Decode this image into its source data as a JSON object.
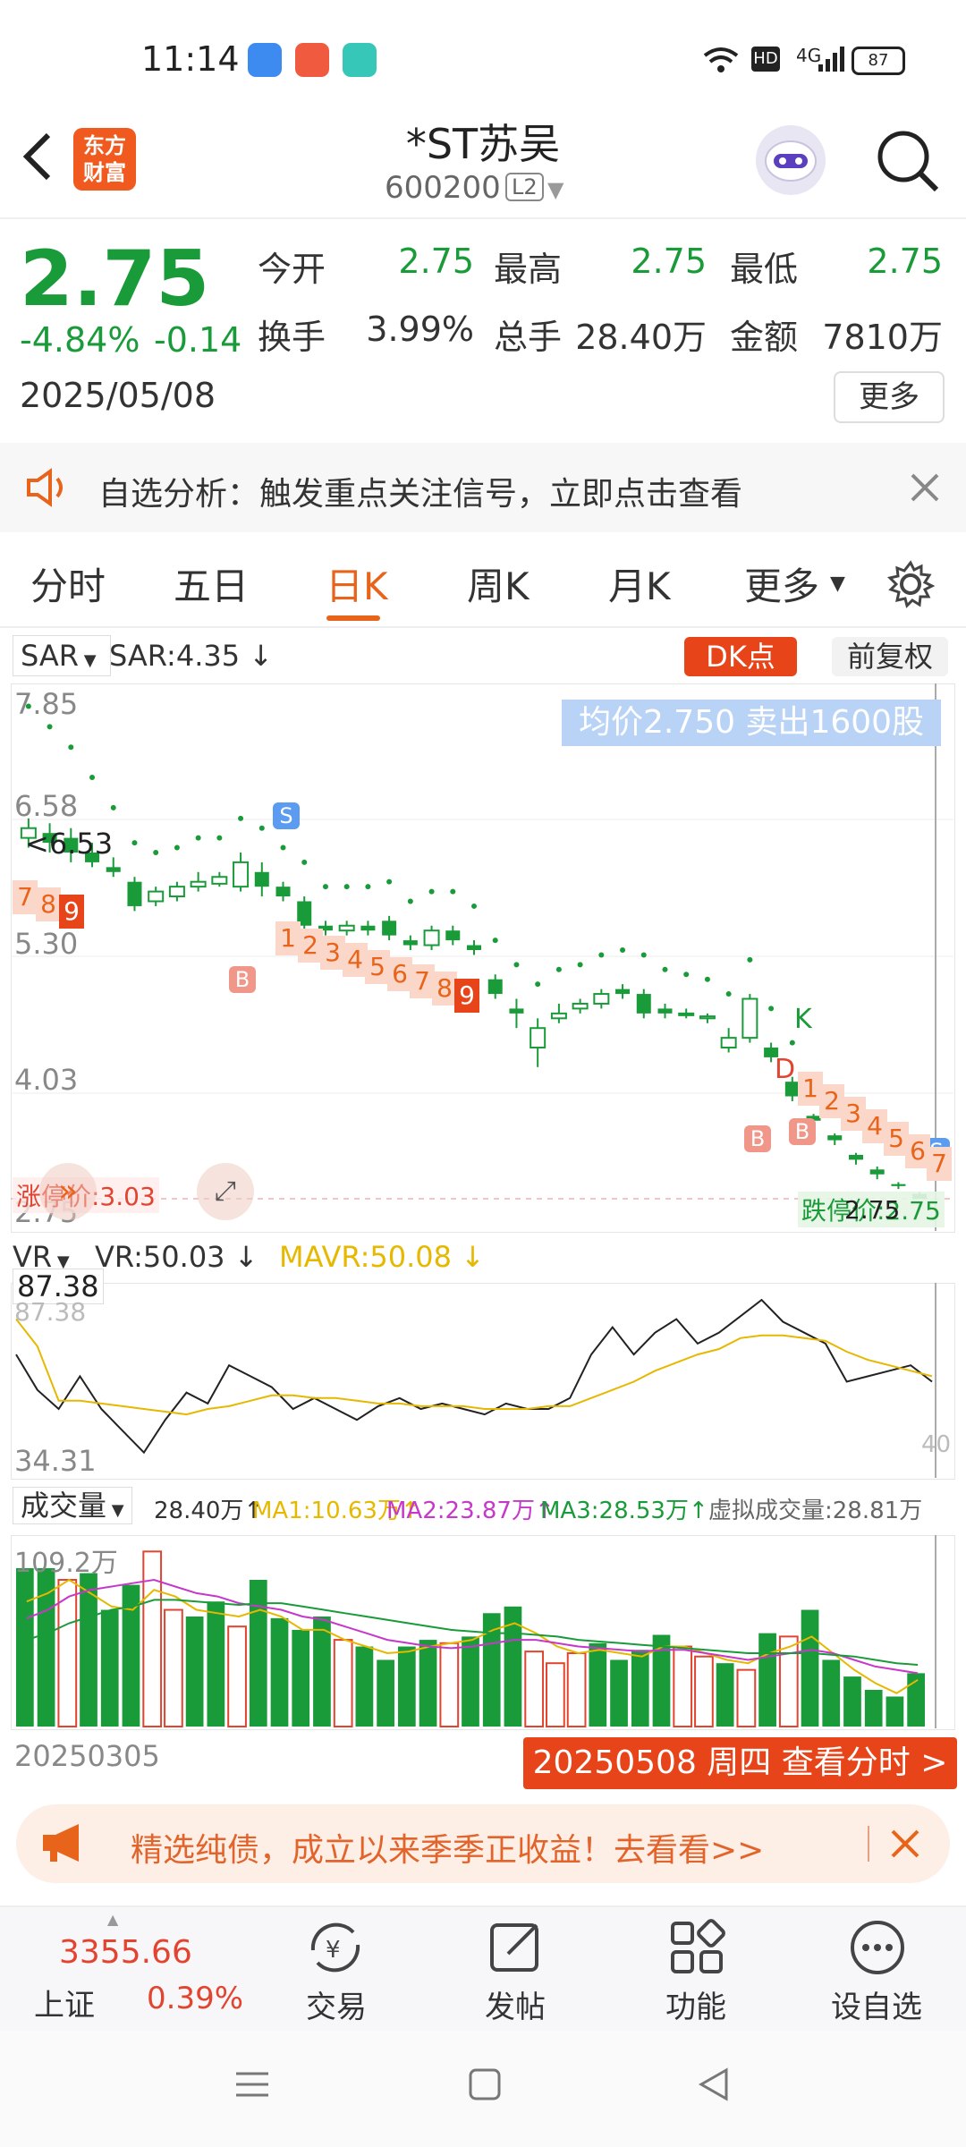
{
  "status_bar": {
    "time": "11:14",
    "network": "4G",
    "battery": "87"
  },
  "header": {
    "back_icon": "chevron-left-icon",
    "logo_line1": "东方",
    "logo_line2": "财富",
    "stock_name": "*ST苏吴",
    "stock_code": "600200",
    "level": "L2"
  },
  "quote": {
    "price": "2.75",
    "change_pct": "-4.84%",
    "change": "-0.14",
    "date": "2025/05/08",
    "open_label": "今开",
    "open": "2.75",
    "high_label": "最高",
    "high": "2.75",
    "low_label": "最低",
    "low": "2.75",
    "turnover_label": "换手",
    "turnover": "3.99%",
    "volume_label": "总手",
    "volume": "28.40万",
    "amount_label": "金额",
    "amount": "7810万",
    "more_label": "更多"
  },
  "notice": {
    "text": "自选分析：触发重点关注信号，立即点击查看"
  },
  "tabs": [
    "分时",
    "五日",
    "日K",
    "周K",
    "月K",
    "更多"
  ],
  "active_tab": "日K",
  "kline": {
    "indicator": "SAR",
    "indicator_value": "SAR:4.35",
    "dk_label": "DK点",
    "fq_label": "前复权",
    "banner": "均价2.750  卖出1600股",
    "y_labels": [
      "7.85",
      "6.58",
      "5.30",
      "4.03",
      "2.75"
    ],
    "marker_left": "6.53",
    "limit_up_label": "涨停价:3.03",
    "limit_down_label": "跌停价:2.75",
    "last_label": "2.75",
    "k_label": "K",
    "d_label": "D",
    "b_label": "B",
    "s_label": "S",
    "td_left": [
      "7",
      "8",
      "9"
    ],
    "td_mid": [
      "1",
      "2",
      "3",
      "4",
      "5",
      "6",
      "7",
      "8",
      "9"
    ],
    "td_right": [
      "1",
      "2",
      "3",
      "4",
      "5",
      "6",
      "7"
    ]
  },
  "vr": {
    "name": "VR",
    "value": "VR:50.03",
    "mavr": "MAVR:50.08",
    "max_label": "87.38",
    "max_label_faint": "87.38",
    "min_label": "34.31",
    "right_label": "40",
    "vr_values": [
      72,
      59,
      52,
      64,
      52,
      44,
      36,
      48,
      58,
      54,
      68,
      64,
      60,
      52,
      56,
      52,
      48,
      53,
      56,
      52,
      54,
      52,
      50,
      54,
      52,
      52,
      56,
      72,
      82,
      72,
      80,
      85,
      76,
      80,
      86,
      92,
      84,
      80,
      76,
      62,
      64,
      66,
      68,
      62
    ],
    "mavr_values": [
      85,
      75,
      55,
      55,
      54,
      53,
      52,
      51,
      50,
      52,
      53,
      55,
      57,
      57,
      56,
      56,
      55,
      54,
      54,
      53,
      53,
      53,
      52,
      52,
      52,
      53,
      53,
      56,
      59,
      62,
      66,
      69,
      72,
      74,
      78,
      79,
      79,
      78,
      77,
      73,
      70,
      68,
      66,
      64
    ]
  },
  "volume": {
    "label": "成交量",
    "value": "28.40万",
    "ma1": "MA1:10.63万",
    "ma2": "MA2:23.87万",
    "ma3": "MA3:28.53万",
    "virtual": "虚拟成交量:28.81万",
    "max_label": "109.2万",
    "start_date": "20250305",
    "detail_button": "20250508 周四 查看分时 >"
  },
  "ad": {
    "text": "精选纯债，成立以来季季正收益！去看看>>"
  },
  "bottom_nav": {
    "index_value": "3355.66",
    "index_name": "上证",
    "index_pct": "0.39%",
    "trade": "交易",
    "post": "发帖",
    "features": "功能",
    "watchlist": "设自选"
  },
  "colors": {
    "up": "#e2442f",
    "down": "#1a9b3a",
    "accent": "#e8641a",
    "vr_line": "#222222",
    "mavr_line": "#e6b800",
    "ma1": "#e6b800",
    "ma2": "#c638c9",
    "ma3": "#1a9b3a"
  }
}
